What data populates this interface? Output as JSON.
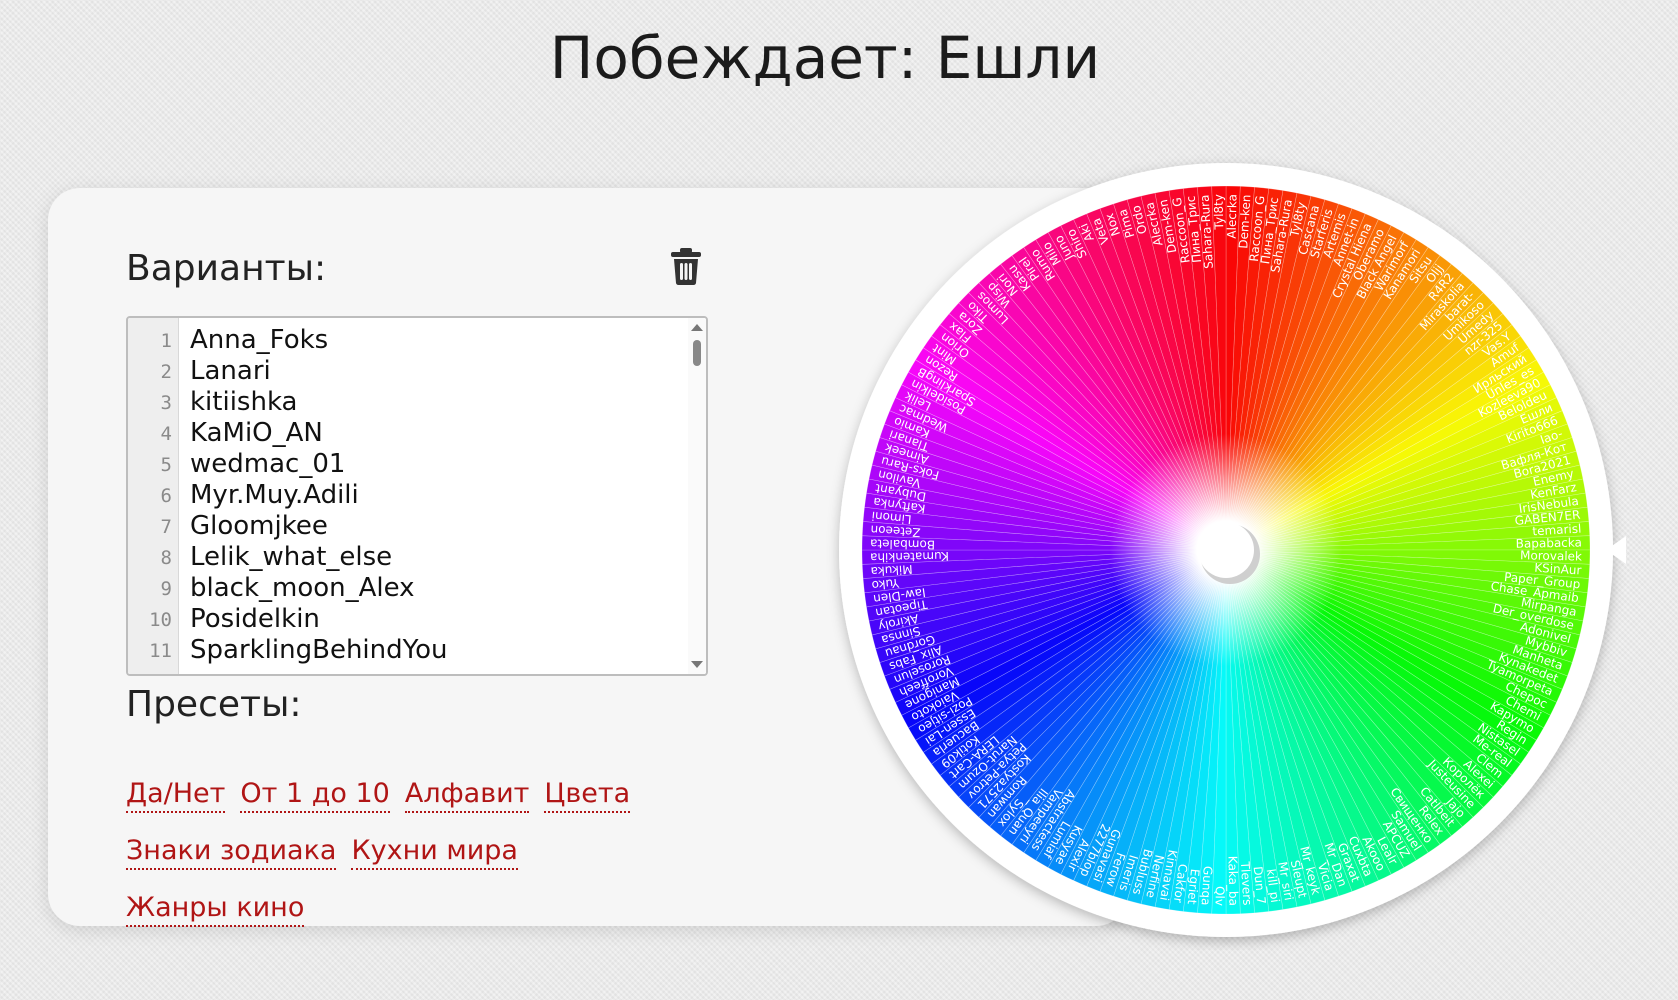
{
  "winner": "Побеждает: Ешли",
  "options_heading": "Варианты:",
  "presets_heading": "Пресеты:",
  "icons": {
    "clear": "trash-icon"
  },
  "lines": [
    {
      "n": "1",
      "text": "Anna_Foks"
    },
    {
      "n": "2",
      "text": "Lanari"
    },
    {
      "n": "3",
      "text": "kitiishka"
    },
    {
      "n": "4",
      "text": "KaMiO_AN"
    },
    {
      "n": "5",
      "text": "wedmac_01"
    },
    {
      "n": "6",
      "text": "Myr.Muy.Adili"
    },
    {
      "n": "7",
      "text": "Gloomjkee"
    },
    {
      "n": "8",
      "text": "Lelik_what_else"
    },
    {
      "n": "9",
      "text": "black_moon_Alex"
    },
    {
      "n": "10",
      "text": "Posidelkin"
    },
    {
      "n": "11",
      "text": "SparklingBehindYou"
    }
  ],
  "presets": [
    "Да/Нет",
    "От 1 до 10",
    "Алфавит",
    "Цвета",
    "Знаки зодиака",
    "Кухни мира",
    "Жанры кино"
  ],
  "wheel": {
    "selected": "Ешли",
    "segment_count": 160,
    "labels": [
      "Alecrka",
      "Dem-ken",
      "Raccoon_G",
      "Пина_Трис",
      "Sahara-Rura",
      "Tyl8ty",
      "Cascana",
      "Starferis",
      "Artemis",
      "Annet-in",
      "Crystal Hiena",
      "Oberamo",
      "Black Angel",
      "Warimorf",
      "Kanamori",
      "Sitsu",
      "Oljj",
      "R4R2",
      "Miraskolia",
      "barat-",
      "Umikoso",
      "Umedy",
      "nzr-325",
      "Vas.Y",
      "Amuf",
      "Ирльский",
      "Unles_es",
      "Kozleeva90",
      "Beloldeu",
      "Ешли",
      "Kirito666",
      "Iao-",
      "Вафля-Кот",
      "Bora2021",
      "Enemy",
      "KenFarz",
      "IrisNebula",
      "GABEN7ER",
      "temarisl",
      "Bapabacka",
      "Morovalek",
      "KSinAur",
      "Paper_Group",
      "Chase_Apmaib",
      "Mirpanga",
      "Der_overdose",
      "Adonivel",
      "Mybbiv",
      "Manheta",
      "Kynakedet",
      "Tyamorpeta",
      "Chepoc",
      "Chemi",
      "Kapymo",
      "Regin",
      "Nistasel",
      "Me-real",
      "Clem",
      "Alexei",
      "Королёк",
      "Justeusine",
      "Jajo",
      "Catlbeit",
      "Relex",
      "Свищенко",
      "Samuel",
      "APCUZ",
      "Lealr",
      "Akooo",
      "Cuxbta",
      "Graxat",
      "Mr_Dan",
      "Vicia",
      "Mr_keyk",
      "Sleupt",
      "Mr_siri",
      "kill_pi",
      "Dun_7",
      "Tlevers",
      "Kaka_ba",
      "Qlv",
      "Gunqa",
      "Egriet",
      "Cakfor",
      "Kinnavai",
      "Nerfine",
      "Bubluss",
      "Imeris",
      "Ferow",
      "Gunavasi",
      "2277blop",
      "Alexir",
      "Kusyae",
      "Lumiaf",
      "Abstractess",
      "Vampeeyri",
      "Ilia_Quan",
      "Sylox",
      "Romwan",
      "Kostya2571",
      "Petya-Petrov",
      "Narut-Ozum",
      "LERA-Cart",
      "Kotik09",
      "Bacuerla",
      "Essen-Lai",
      "Pozi-sitjeo",
      "Vaiokoto",
      "Manigone",
      "Voroffeeh",
      "Roroselun",
      "Alix_Fabs",
      "Gordnau",
      "Sinnsa",
      "Akiroly",
      "Tipeotan",
      "Iaw-Dlen",
      "Yuko",
      "Mikuka",
      "Kumatenkiha",
      "Bombaleta",
      "Zeteeon",
      "Limoni",
      "Kaftynka",
      "Dubyant",
      "Vavilon",
      "Foks-Raru",
      "Aimeek",
      "Tlanari",
      "Kamio",
      "Wedmac",
      "Lelik",
      "Posidelkin",
      "SparklingB",
      "Rezon",
      "Mint",
      "Orion",
      "Flax",
      "Zora",
      "Tiko",
      "Lumos",
      "Wisp",
      "Nori",
      "Kasu",
      "Pirel",
      "Rumo",
      "Milo",
      "Juno",
      "Shiro",
      "Aki",
      "Veta",
      "Nox",
      "Pima",
      "Ordo"
    ]
  }
}
